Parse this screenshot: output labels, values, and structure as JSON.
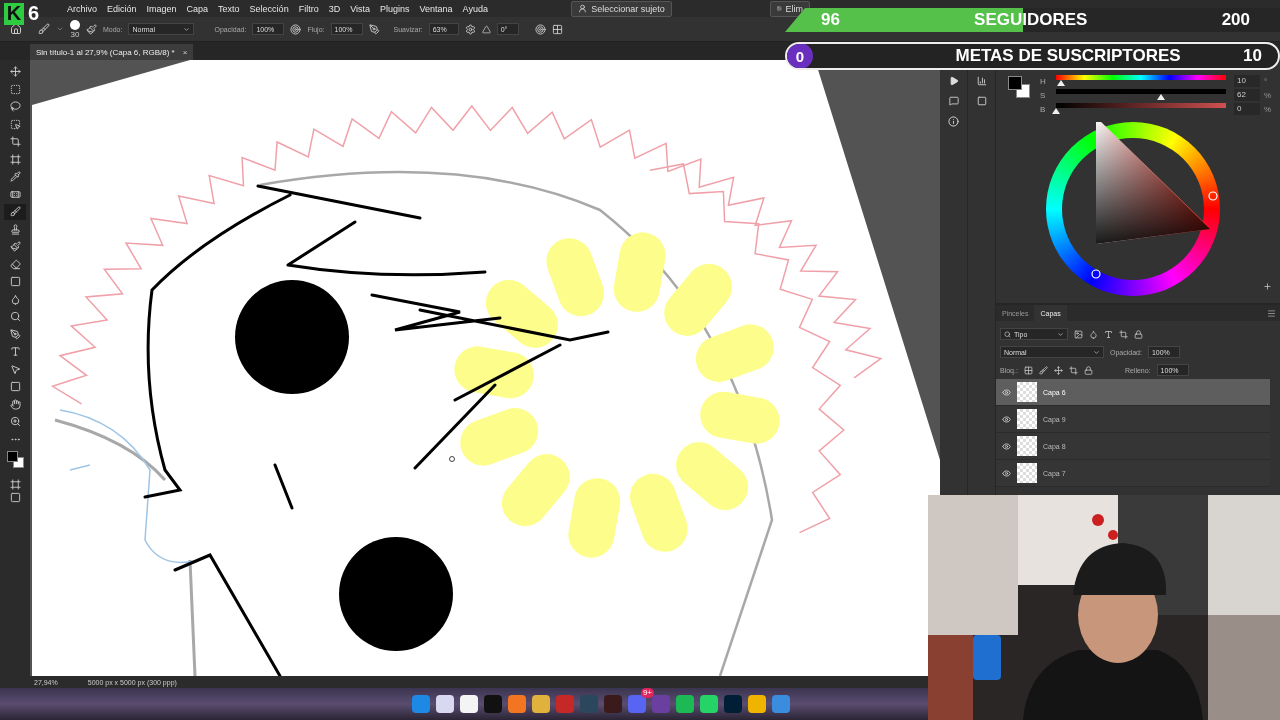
{
  "logo": {
    "letter": "K",
    "number": "6"
  },
  "menu": [
    "Archivo",
    "Edición",
    "Imagen",
    "Capa",
    "Texto",
    "Selección",
    "Filtro",
    "3D",
    "Vista",
    "Plugins",
    "Ventana",
    "Ayuda"
  ],
  "select_subject": "Seleccionar sujeto",
  "remove_button": "Elim",
  "options_bar": {
    "brush_size": "30",
    "mode_label": "Modo:",
    "mode": "Normal",
    "opacity_label": "Opacidad:",
    "opacity": "100%",
    "flow_label": "Flujo:",
    "flow": "100%",
    "smoothing_label": "Suavizar:",
    "smoothing": "63%",
    "angle": "0°"
  },
  "document_tab": {
    "title": "Sin título-1 al 27,9% (Capa 6, RGB/8) *",
    "close": "×"
  },
  "tools": [
    {
      "kind": "move",
      "selected": false
    },
    {
      "kind": "marquee",
      "selected": false
    },
    {
      "kind": "lasso",
      "selected": false
    },
    {
      "kind": "object-select",
      "selected": false
    },
    {
      "kind": "crop",
      "selected": false
    },
    {
      "kind": "frame",
      "selected": false
    },
    {
      "kind": "eyedropper",
      "selected": false
    },
    {
      "kind": "healing",
      "selected": false
    },
    {
      "kind": "brush",
      "selected": true
    },
    {
      "kind": "stamp",
      "selected": false
    },
    {
      "kind": "history-brush",
      "selected": false
    },
    {
      "kind": "eraser",
      "selected": false
    },
    {
      "kind": "gradient",
      "selected": false
    },
    {
      "kind": "blur",
      "selected": false
    },
    {
      "kind": "dodge",
      "selected": false
    },
    {
      "kind": "pen",
      "selected": false
    },
    {
      "kind": "type",
      "selected": false
    },
    {
      "kind": "path-select",
      "selected": false
    },
    {
      "kind": "rectangle",
      "selected": false
    },
    {
      "kind": "hand",
      "selected": false
    },
    {
      "kind": "zoom",
      "selected": false
    },
    {
      "kind": "more",
      "selected": false
    }
  ],
  "color_panel": {
    "channels": [
      {
        "label": "H",
        "value": "10",
        "unit": "°",
        "level": 0.03
      },
      {
        "label": "S",
        "value": "62",
        "unit": "%",
        "level": 0.62
      },
      {
        "label": "B",
        "value": "0",
        "unit": "%",
        "level": 0
      }
    ]
  },
  "layers_panel": {
    "tabs": [
      {
        "label": "Pinceles",
        "selected": false
      },
      {
        "label": "Capas",
        "selected": true
      }
    ],
    "filter": "Tipo",
    "blend_mode": "Normal",
    "opacity_label": "Opacidad:",
    "opacity": "100%",
    "lock_label": "Bloq.:",
    "fill_label": "Relleno:",
    "fill": "100%",
    "layers": [
      {
        "name": "Capa 6",
        "visible": true,
        "selected": true
      },
      {
        "name": "Capa 9",
        "visible": true,
        "selected": false
      },
      {
        "name": "Capa 8",
        "visible": true,
        "selected": false
      },
      {
        "name": "Capa 7",
        "visible": true,
        "selected": false
      }
    ]
  },
  "status_bar": {
    "zoom": "27,94%",
    "size": "5000 px x 5000 px (300 ppp)"
  },
  "taskbar": {
    "badge": "9+"
  },
  "followers_goal": {
    "current": "96",
    "label": "SEGUIDORES",
    "target": "200",
    "level": 0.48
  },
  "subscribers_goal": {
    "current": "0",
    "label": "METAS DE SUSCRIPTORES",
    "target": "10",
    "level": 0
  }
}
